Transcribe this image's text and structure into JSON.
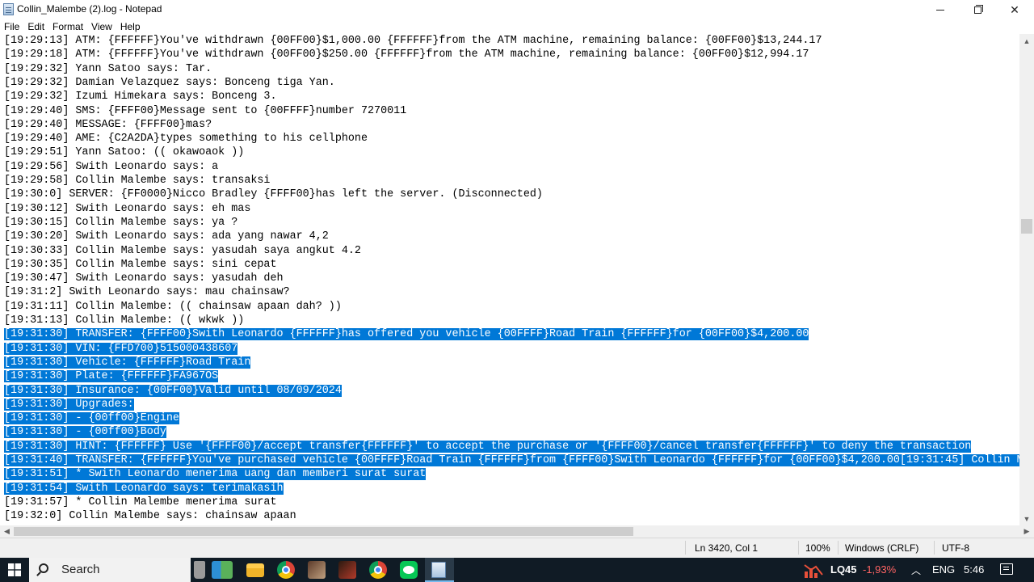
{
  "window": {
    "title": "Collin_Malembe (2).log - Notepad",
    "controls": {
      "minimize": "minimize",
      "maximize": "restore",
      "close": "✕"
    }
  },
  "menu": [
    "File",
    "Edit",
    "Format",
    "View",
    "Help"
  ],
  "lines": [
    {
      "text": "[19:29:13] ATM: {FFFFFF}You've withdrawn {00FF00}$1,000.00 {FFFFFF}from the ATM machine, remaining balance: {00FF00}$13,244.17",
      "selected": false
    },
    {
      "text": "[19:29:18] ATM: {FFFFFF}You've withdrawn {00FF00}$250.00 {FFFFFF}from the ATM machine, remaining balance: {00FF00}$12,994.17",
      "selected": false
    },
    {
      "text": "[19:29:32] Yann Satoo says: Tar.",
      "selected": false
    },
    {
      "text": "[19:29:32] Damian Velazquez says: Bonceng tiga Yan.",
      "selected": false
    },
    {
      "text": "[19:29:32] Izumi Himekara says: Bonceng 3.",
      "selected": false
    },
    {
      "text": "[19:29:40] SMS: {FFFF00}Message sent to {00FFFF}number 7270011",
      "selected": false
    },
    {
      "text": "[19:29:40] MESSAGE: {FFFF00}mas?",
      "selected": false
    },
    {
      "text": "[19:29:40] AME: {C2A2DA}types something to his cellphone",
      "selected": false
    },
    {
      "text": "[19:29:51] Yann Satoo: (( okawoaok ))",
      "selected": false
    },
    {
      "text": "[19:29:56] Swith Leonardo says: a",
      "selected": false
    },
    {
      "text": "[19:29:58] Collin Malembe says: transaksi",
      "selected": false
    },
    {
      "text": "[19:30:0] SERVER: {FF0000}Nicco Bradley {FFFF00}has left the server. (Disconnected)",
      "selected": false
    },
    {
      "text": "[19:30:12] Swith Leonardo says: eh mas",
      "selected": false
    },
    {
      "text": "[19:30:15] Collin Malembe says: ya ?",
      "selected": false
    },
    {
      "text": "[19:30:20] Swith Leonardo says: ada yang nawar 4,2",
      "selected": false
    },
    {
      "text": "[19:30:33] Collin Malembe says: yasudah saya angkut 4.2",
      "selected": false
    },
    {
      "text": "[19:30:35] Collin Malembe says: sini cepat",
      "selected": false
    },
    {
      "text": "[19:30:47] Swith Leonardo says: yasudah deh",
      "selected": false
    },
    {
      "text": "[19:31:2] Swith Leonardo says: mau chainsaw?",
      "selected": false
    },
    {
      "text": "[19:31:11] Collin Malembe: (( chainsaw apaan dah? ))",
      "selected": false
    },
    {
      "text": "[19:31:13] Collin Malembe: (( wkwk ))",
      "selected": false
    },
    {
      "text": "[19:31:30] TRANSFER: {FFFF00}Swith Leonardo {FFFFFF}has offered you vehicle {00FFFF}Road Train {FFFFFF}for {00FF00}$4,200.00",
      "selected": true
    },
    {
      "text": "[19:31:30] VIN: {FFD700}515000438607",
      "selected": true
    },
    {
      "text": "[19:31:30] Vehicle: {FFFFFF}Road Train",
      "selected": true
    },
    {
      "text": "[19:31:30] Plate: {FFFFFF}FA967OS",
      "selected": true
    },
    {
      "text": "[19:31:30] Insurance: {00FF00}Valid until 08/09/2024",
      "selected": true
    },
    {
      "text": "[19:31:30] Upgrades:",
      "selected": true
    },
    {
      "text": "[19:31:30] - {00ff00}Engine",
      "selected": true
    },
    {
      "text": "[19:31:30] - {00ff00}Body",
      "selected": true
    },
    {
      "text": "[19:31:30] HINT: {FFFFFF} Use '{FFFF00}/accept transfer{FFFFFF}' to accept the purchase or '{FFFF00}/cancel transfer{FFFFFF}' to deny the transaction",
      "selected": true
    },
    {
      "text": "[19:31:40] TRANSFER: {FFFFFF}You've purchased vehicle {00FFFF}Road Train {FFFFFF}from {FFFF00}Swith Leonardo {FFFFFF}for {00FF00}$4,200.00[19:31:45] Collin M",
      "selected": true
    },
    {
      "text": "[19:31:51] * Swith Leonardo menerima uang dan memberi surat surat",
      "selected": true
    },
    {
      "text": "[19:31:54] Swith Leonardo says: terimakasih",
      "selected": true
    },
    {
      "text": "[19:31:57] * Collin Malembe menerima surat",
      "selected": false
    },
    {
      "text": "[19:32:0] Collin Malembe says: chainsaw apaan",
      "selected": false
    }
  ],
  "status": {
    "position": "Ln 3420, Col 1",
    "zoom": "100%",
    "line_ending": "Windows (CRLF)",
    "encoding": "UTF-8"
  },
  "taskbar": {
    "search_label": "Search",
    "apps": [
      "trash-app",
      "library-app",
      "file-explorer",
      "chrome",
      "game-app-1",
      "game-app-2",
      "chrome-profile",
      "line-app",
      "notepad"
    ],
    "stock_ticker": "LQ45",
    "stock_change": "-1,93%",
    "language": "ENG",
    "time": "5:46"
  },
  "colors": {
    "selection": "#0078d7",
    "taskbar_bg": "#101b25",
    "stock_negative": "#ff6464"
  }
}
